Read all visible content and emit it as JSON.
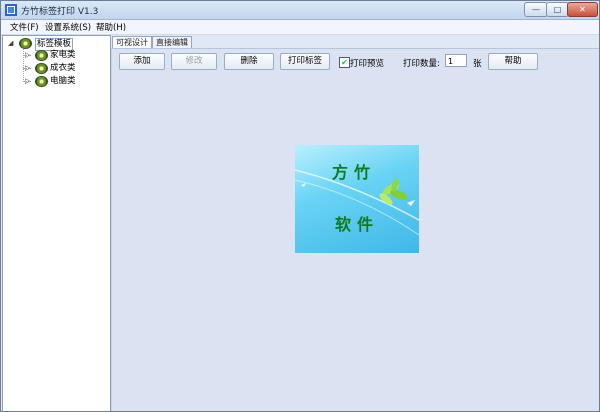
{
  "window": {
    "title": "方竹标签打印 V1.3",
    "controls": {
      "minimize": "—",
      "maximize": "□",
      "close": "✕"
    }
  },
  "menu": {
    "items": [
      "文件(F)",
      "设置系统(S)",
      "帮助(H)"
    ]
  },
  "tree": {
    "root": "标签模板",
    "children": [
      "家电类",
      "成衣类",
      "电脑类"
    ]
  },
  "tabs": [
    "可视设计",
    "直接编辑"
  ],
  "toolbar": {
    "add": "添加",
    "edit": "修改",
    "delete": "删除",
    "print_label": "打印标签",
    "print_preview": "打印预览",
    "print_preview_checked": true,
    "quantity_label": "打印数量:",
    "quantity_value": "1",
    "quantity_unit": "张",
    "help": "帮助"
  },
  "logo": {
    "line1": "方竹",
    "line2": "软件"
  },
  "colors": {
    "content_bg": "#dbe3f2",
    "logo_text": "#0f7a1f",
    "logo_sky": "#69d3f4"
  }
}
